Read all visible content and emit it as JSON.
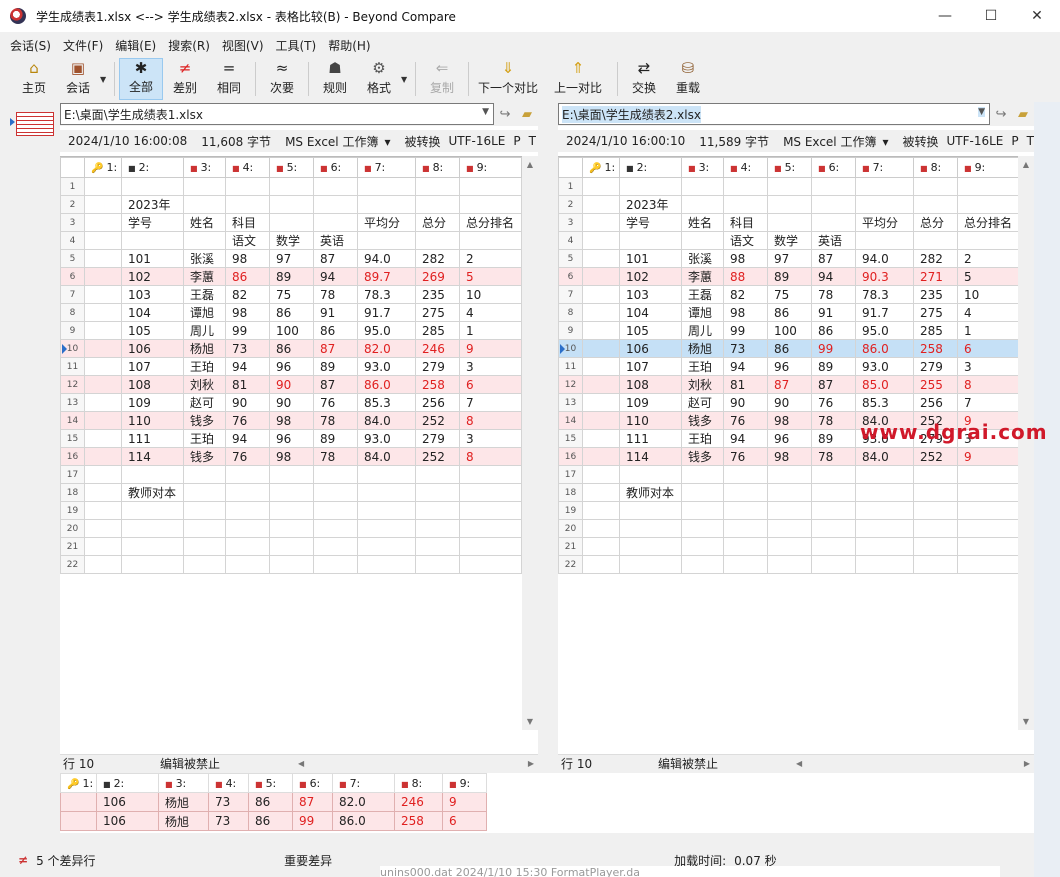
{
  "window": {
    "title": "学生成绩表1.xlsx <--> 学生成绩表2.xlsx - 表格比较(B) - Beyond Compare",
    "minimize": "—",
    "maximize": "☐",
    "close": "✕"
  },
  "menu": [
    "会话(S)",
    "文件(F)",
    "编辑(E)",
    "搜索(R)",
    "视图(V)",
    "工具(T)",
    "帮助(H)"
  ],
  "toolbar": {
    "home": {
      "label": "主页",
      "icon": "home-icon"
    },
    "session": {
      "label": "会话",
      "icon": "briefcase-icon"
    },
    "all": {
      "label": "全部",
      "icon": "asterisk-icon",
      "glyph": "✱"
    },
    "diffs": {
      "label": "差别",
      "icon": "not-equal-icon",
      "glyph": "≠"
    },
    "same": {
      "label": "相同",
      "icon": "equal-icon",
      "glyph": "="
    },
    "minor": {
      "label": "次要",
      "icon": "approx-icon",
      "glyph": "≈"
    },
    "rules": {
      "label": "规则",
      "icon": "referee-icon"
    },
    "format": {
      "label": "格式",
      "icon": "format-icon"
    },
    "copy": {
      "label": "复制",
      "icon": "arrow-left-icon"
    },
    "next": {
      "label": "下一个对比",
      "icon": "arrow-down-icon"
    },
    "prev": {
      "label": "上一对比",
      "icon": "arrow-up-icon"
    },
    "swap": {
      "label": "交换",
      "icon": "swap-icon"
    },
    "reload": {
      "label": "重载",
      "icon": "reload-icon"
    }
  },
  "left": {
    "path": "E:\\桌面\\学生成绩表1.xlsx",
    "info": {
      "date": "2024/1/10 16:00:08",
      "size": "11,608 字节",
      "type": "MS Excel 工作簿",
      "conv": "被转换",
      "enc": "UTF-16LE",
      "p": "P",
      "t": "T"
    },
    "status": {
      "row": "行 10",
      "edit": "编辑被禁止"
    }
  },
  "right": {
    "path": "E:\\桌面\\学生成绩表2.xlsx",
    "info": {
      "date": "2024/1/10 16:00:10",
      "size": "11,589 字节",
      "type": "MS Excel 工作簿",
      "conv": "被转换",
      "enc": "UTF-16LE",
      "p": "P",
      "t": "T"
    },
    "status": {
      "row": "行 10",
      "edit": "编辑被禁止"
    }
  },
  "columns": [
    "1:",
    "2:",
    "3:",
    "4:",
    "5:",
    "6:",
    "7:",
    "8:",
    "9:"
  ],
  "left_rows": [
    {
      "n": "1",
      "c": [
        "",
        "",
        "",
        "",
        "",
        "",
        "",
        "",
        ""
      ]
    },
    {
      "n": "2",
      "c": [
        "",
        "2023年",
        "",
        "",
        "",
        "",
        "",
        "",
        ""
      ]
    },
    {
      "n": "3",
      "c": [
        "",
        "学号",
        "姓名",
        "科目",
        "",
        "",
        "平均分",
        "总分",
        "总分排名"
      ]
    },
    {
      "n": "4",
      "c": [
        "",
        "",
        "",
        "语文",
        "数学",
        "英语",
        "",
        "",
        ""
      ]
    },
    {
      "n": "5",
      "c": [
        "",
        "101",
        "张溪",
        "98",
        "97",
        "87",
        "94.0",
        "282",
        "2"
      ]
    },
    {
      "n": "6",
      "c": [
        "",
        "102",
        "李蕙",
        "86",
        "89",
        "94",
        "89.7",
        "269",
        "5"
      ],
      "diff": true,
      "red": [
        3,
        6,
        7,
        8
      ]
    },
    {
      "n": "7",
      "c": [
        "",
        "103",
        "王磊",
        "82",
        "75",
        "78",
        "78.3",
        "235",
        "10"
      ]
    },
    {
      "n": "8",
      "c": [
        "",
        "104",
        "谭旭",
        "98",
        "86",
        "91",
        "91.7",
        "275",
        "4"
      ]
    },
    {
      "n": "9",
      "c": [
        "",
        "105",
        "周儿",
        "99",
        "100",
        "86",
        "95.0",
        "285",
        "1"
      ]
    },
    {
      "n": "10",
      "c": [
        "",
        "106",
        "杨旭",
        "73",
        "86",
        "87",
        "82.0",
        "246",
        "9"
      ],
      "diff": true,
      "red": [
        5,
        6,
        7,
        8
      ],
      "arrow": true
    },
    {
      "n": "11",
      "c": [
        "",
        "107",
        "王珀",
        "94",
        "96",
        "89",
        "93.0",
        "279",
        "3"
      ]
    },
    {
      "n": "12",
      "c": [
        "",
        "108",
        "刘秋",
        "81",
        "90",
        "87",
        "86.0",
        "258",
        "6"
      ],
      "diff": true,
      "red": [
        4,
        6,
        7,
        8
      ]
    },
    {
      "n": "13",
      "c": [
        "",
        "109",
        "赵可",
        "90",
        "90",
        "76",
        "85.3",
        "256",
        "7"
      ]
    },
    {
      "n": "14",
      "c": [
        "",
        "110",
        "钱多",
        "76",
        "98",
        "78",
        "84.0",
        "252",
        "8"
      ],
      "diff": true,
      "red": [
        8
      ]
    },
    {
      "n": "15",
      "c": [
        "",
        "111",
        "王珀",
        "94",
        "96",
        "89",
        "93.0",
        "279",
        "3"
      ]
    },
    {
      "n": "16",
      "c": [
        "",
        "114",
        "钱多",
        "76",
        "98",
        "78",
        "84.0",
        "252",
        "8"
      ],
      "diff": true,
      "red": [
        8
      ]
    },
    {
      "n": "17",
      "c": [
        "",
        "",
        "",
        "",
        "",
        "",
        "",
        "",
        ""
      ]
    },
    {
      "n": "18",
      "c": [
        "",
        "教师对本",
        "",
        "",
        "",
        "",
        "",
        "",
        ""
      ]
    },
    {
      "n": "19",
      "c": [
        "",
        "",
        "",
        "",
        "",
        "",
        "",
        "",
        ""
      ]
    },
    {
      "n": "20",
      "c": [
        "",
        "",
        "",
        "",
        "",
        "",
        "",
        "",
        ""
      ]
    },
    {
      "n": "21",
      "c": [
        "",
        "",
        "",
        "",
        "",
        "",
        "",
        "",
        ""
      ]
    },
    {
      "n": "22",
      "c": [
        "",
        "",
        "",
        "",
        "",
        "",
        "",
        "",
        ""
      ]
    }
  ],
  "right_rows": [
    {
      "n": "1",
      "c": [
        "",
        "",
        "",
        "",
        "",
        "",
        "",
        "",
        ""
      ]
    },
    {
      "n": "2",
      "c": [
        "",
        "2023年",
        "",
        "",
        "",
        "",
        "",
        "",
        ""
      ]
    },
    {
      "n": "3",
      "c": [
        "",
        "学号",
        "姓名",
        "科目",
        "",
        "",
        "平均分",
        "总分",
        "总分排名"
      ]
    },
    {
      "n": "4",
      "c": [
        "",
        "",
        "",
        "语文",
        "数学",
        "英语",
        "",
        "",
        ""
      ]
    },
    {
      "n": "5",
      "c": [
        "",
        "101",
        "张溪",
        "98",
        "97",
        "87",
        "94.0",
        "282",
        "2"
      ]
    },
    {
      "n": "6",
      "c": [
        "",
        "102",
        "李蕙",
        "88",
        "89",
        "94",
        "90.3",
        "271",
        "5"
      ],
      "diff": true,
      "red": [
        3,
        6,
        7
      ]
    },
    {
      "n": "7",
      "c": [
        "",
        "103",
        "王磊",
        "82",
        "75",
        "78",
        "78.3",
        "235",
        "10"
      ]
    },
    {
      "n": "8",
      "c": [
        "",
        "104",
        "谭旭",
        "98",
        "86",
        "91",
        "91.7",
        "275",
        "4"
      ]
    },
    {
      "n": "9",
      "c": [
        "",
        "105",
        "周儿",
        "99",
        "100",
        "86",
        "95.0",
        "285",
        "1"
      ]
    },
    {
      "n": "10",
      "c": [
        "",
        "106",
        "杨旭",
        "73",
        "86",
        "99",
        "86.0",
        "258",
        "6"
      ],
      "cur": true,
      "red": [
        5,
        6,
        7,
        8
      ],
      "arrow": true
    },
    {
      "n": "11",
      "c": [
        "",
        "107",
        "王珀",
        "94",
        "96",
        "89",
        "93.0",
        "279",
        "3"
      ]
    },
    {
      "n": "12",
      "c": [
        "",
        "108",
        "刘秋",
        "81",
        "87",
        "87",
        "85.0",
        "255",
        "8"
      ],
      "diff": true,
      "red": [
        4,
        6,
        7,
        8
      ]
    },
    {
      "n": "13",
      "c": [
        "",
        "109",
        "赵可",
        "90",
        "90",
        "76",
        "85.3",
        "256",
        "7"
      ]
    },
    {
      "n": "14",
      "c": [
        "",
        "110",
        "钱多",
        "76",
        "98",
        "78",
        "84.0",
        "252",
        "9"
      ],
      "diff": true,
      "red": [
        8
      ]
    },
    {
      "n": "15",
      "c": [
        "",
        "111",
        "王珀",
        "94",
        "96",
        "89",
        "93.0",
        "279",
        "3"
      ]
    },
    {
      "n": "16",
      "c": [
        "",
        "114",
        "钱多",
        "76",
        "98",
        "78",
        "84.0",
        "252",
        "9"
      ],
      "diff": true,
      "red": [
        8
      ]
    },
    {
      "n": "17",
      "c": [
        "",
        "",
        "",
        "",
        "",
        "",
        "",
        "",
        ""
      ]
    },
    {
      "n": "18",
      "c": [
        "",
        "教师对本",
        "",
        "",
        "",
        "",
        "",
        "",
        ""
      ]
    },
    {
      "n": "19",
      "c": [
        "",
        "",
        "",
        "",
        "",
        "",
        "",
        "",
        ""
      ]
    },
    {
      "n": "20",
      "c": [
        "",
        "",
        "",
        "",
        "",
        "",
        "",
        "",
        ""
      ]
    },
    {
      "n": "21",
      "c": [
        "",
        "",
        "",
        "",
        "",
        "",
        "",
        "",
        ""
      ]
    },
    {
      "n": "22",
      "c": [
        "",
        "",
        "",
        "",
        "",
        "",
        "",
        "",
        ""
      ]
    }
  ],
  "compare": {
    "columns": [
      "1:",
      "2:",
      "3:",
      "4:",
      "5:",
      "6:",
      "7:",
      "8:",
      "9:"
    ],
    "rows": [
      {
        "c": [
          "",
          "106",
          "杨旭",
          "73",
          "86",
          "87",
          "82.0",
          "246",
          "9"
        ],
        "red": [
          5,
          7,
          8
        ]
      },
      {
        "c": [
          "",
          "106",
          "杨旭",
          "73",
          "86",
          "99",
          "86.0",
          "258",
          "6"
        ],
        "red": [
          5,
          7,
          8
        ]
      }
    ]
  },
  "statusbar": {
    "icon": "not-equal-icon",
    "glyph": "≠",
    "diffs": "5 个差异行",
    "important": "重要差异",
    "load_label": "加载时间:",
    "load_time": "0.07 秒"
  },
  "watermark": "www.dgrai.com",
  "taskbar_fragment": "unins000.dat          2024/1/10 15:30          FormatPlayer.da"
}
